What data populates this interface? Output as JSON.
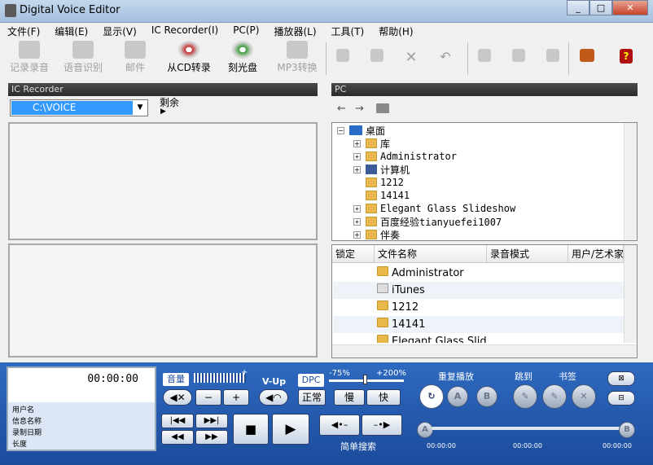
{
  "title": "Digital Voice Editor",
  "menu": [
    "文件(F)",
    "编辑(E)",
    "显示(V)",
    "IC Recorder(I)",
    "PC(P)",
    "播放器(L)",
    "工具(T)",
    "帮助(H)"
  ],
  "toolbar": {
    "record": "记录录音",
    "speech": "语音识别",
    "mail": "邮件",
    "from_cd": "从CD转录",
    "burn": "刻光盘",
    "mp3": "MP3转换"
  },
  "left": {
    "header": "IC Recorder",
    "drive": "C:\\VOICE",
    "remaining": "剩余"
  },
  "right": {
    "header": "PC"
  },
  "tree": [
    "桌面",
    "库",
    "Administrator",
    "计算机",
    "1212",
    "14141",
    "Elegant Glass Slideshow",
    "百度经验tianyuefei1007",
    "伴奏"
  ],
  "list": {
    "columns": [
      "锁定",
      "文件名称",
      "录音模式",
      "用户/艺术家"
    ],
    "rows": [
      "Administrator",
      "iTunes",
      "1212",
      "14141",
      "Elegant Glass Slid"
    ]
  },
  "player": {
    "time": "00:00:00",
    "fields": [
      "用户名",
      "信息名称",
      "录制日期",
      "长度"
    ],
    "volume": "音量",
    "minus": "−",
    "plus": "+",
    "plus_small": "+",
    "vup": "V-Up",
    "dpc": "DPC",
    "dpc_min": "-75%",
    "dpc_max": "+200%",
    "normal": "正常",
    "slow": "慢",
    "fast": "快",
    "repeat": "重复播放",
    "a": "A",
    "b": "B",
    "jump": "跳到",
    "bookmark": "书签",
    "search": "简单搜索",
    "seek_a": "A",
    "seek_b": "B",
    "seek_start": "00:00:00",
    "seek_mid": "00:00:00",
    "seek_end": "00:00:00"
  }
}
